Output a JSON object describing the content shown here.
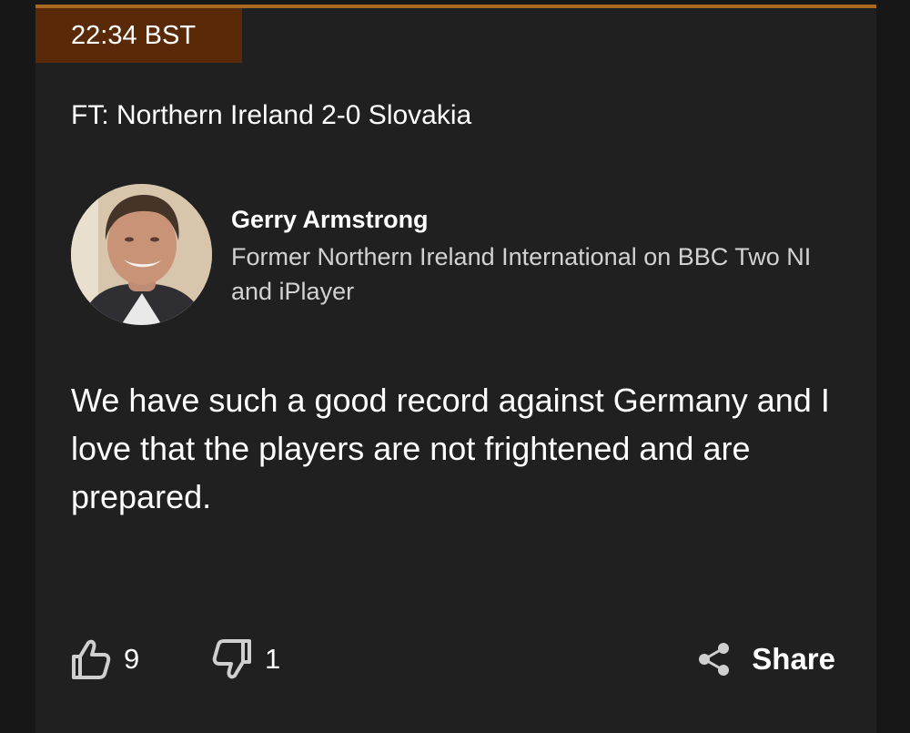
{
  "post": {
    "time": "22:34 BST",
    "headline": "FT: Northern Ireland 2-0 Slovakia",
    "author": {
      "name": "Gerry Armstrong",
      "role": "Former Northern Ireland International on BBC Two NI and iPlayer"
    },
    "quote": "We have such a good record against Germany and I love that the players are not frightened and are prepared."
  },
  "actions": {
    "likes": "9",
    "dislikes": "1",
    "share_label": "Share",
    "icons": [
      "thumbs-up-icon",
      "thumbs-down-icon",
      "share-icon"
    ]
  },
  "colors": {
    "background": "#202020",
    "badge": "#5a2a08",
    "accent_line": "#a86a1f",
    "text": "#ffffff",
    "muted_text": "#d2d2d2"
  }
}
